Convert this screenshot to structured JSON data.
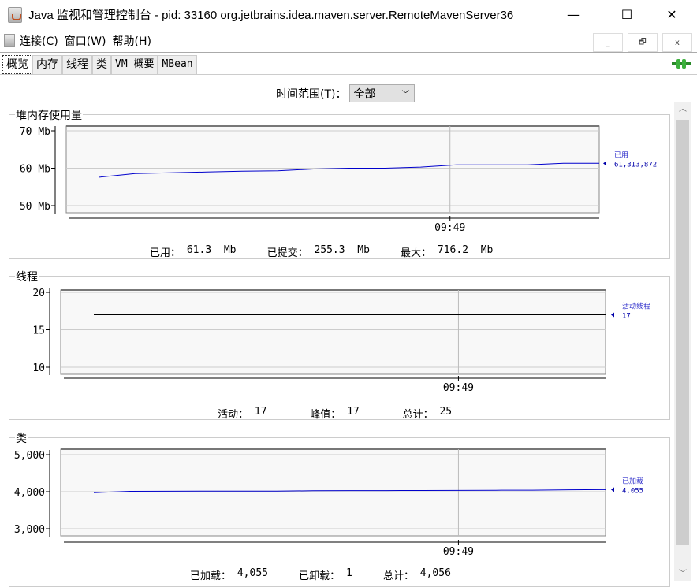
{
  "window": {
    "title": "Java 监视和管理控制台 - pid: 33160 org.jetbrains.idea.maven.server.RemoteMavenServer36",
    "minimize": "—",
    "maximize": "☐",
    "close": "✕"
  },
  "menu": [
    "连接(C)",
    "窗口(W)",
    "帮助(H)"
  ],
  "mdi": {
    "min": "_",
    "restore": "🗗",
    "close": "x"
  },
  "tabs": [
    "概览",
    "内存",
    "线程",
    "类",
    "VM 概要",
    "MBean"
  ],
  "time_range": {
    "label": "时间范围(T)：",
    "value": "全部"
  },
  "colors": {
    "line": "#0000cc",
    "thread_line": "#000000",
    "grid": "#cccccc"
  },
  "chart_data": [
    {
      "type": "line",
      "title": "堆内存使用量",
      "ylim": [
        50,
        70
      ],
      "yticks": [
        "70 Mb",
        "60 Mb",
        "50 Mb"
      ],
      "ytick_values": [
        70,
        60,
        50
      ],
      "xticks": [
        "09:49"
      ],
      "xtick_pos": 0.72,
      "series": [
        {
          "name": "已用",
          "values": [
            57.6,
            58.6,
            58.8,
            59.0,
            59.2,
            59.3,
            59.8,
            60.0,
            60.0,
            60.3,
            60.9,
            60.9,
            60.9,
            61.3,
            61.3
          ],
          "last": "61,313,872"
        }
      ],
      "stats": [
        [
          "已用：",
          "61.3",
          "Mb"
        ],
        [
          "已提交：",
          "255.3",
          "Mb"
        ],
        [
          "最大：",
          "716.2",
          "Mb"
        ]
      ]
    },
    {
      "type": "line",
      "title": "线程",
      "ylim": [
        10,
        20
      ],
      "yticks": [
        "20",
        "15",
        "10"
      ],
      "ytick_values": [
        20,
        15,
        10
      ],
      "xticks": [
        "09:49"
      ],
      "xtick_pos": 0.73,
      "series": [
        {
          "name": "活动线程",
          "values": [
            17,
            17,
            17,
            17,
            17,
            17,
            17,
            17,
            17,
            17,
            17,
            17,
            17,
            17,
            17
          ],
          "last": "17"
        }
      ],
      "stats": [
        [
          "活动：",
          "17",
          ""
        ],
        [
          "峰值：",
          "17",
          ""
        ],
        [
          "总计：",
          "25",
          ""
        ]
      ]
    },
    {
      "type": "line",
      "title": "类",
      "ylim": [
        3000,
        5000
      ],
      "yticks": [
        "5,000",
        "4,000",
        "3,000"
      ],
      "ytick_values": [
        5000,
        4000,
        3000
      ],
      "xticks": [
        "09:49"
      ],
      "xtick_pos": 0.73,
      "series": [
        {
          "name": "已加载",
          "values": [
            3975,
            4010,
            4012,
            4014,
            4016,
            4018,
            4025,
            4030,
            4030,
            4032,
            4035,
            4038,
            4040,
            4050,
            4055
          ],
          "last": "4,055"
        }
      ],
      "stats": [
        [
          "已加载：",
          "4,055",
          ""
        ],
        [
          "已卸载：",
          "1",
          ""
        ],
        [
          "总计：",
          "4,056",
          ""
        ]
      ]
    }
  ]
}
